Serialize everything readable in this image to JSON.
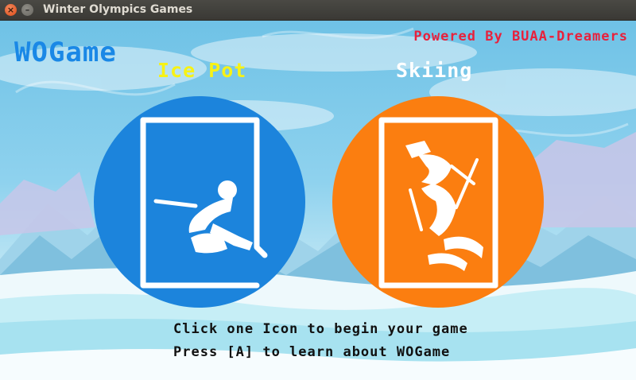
{
  "window": {
    "title": "Winter Olympics Games",
    "close_glyph": "×",
    "minimize_glyph": "–"
  },
  "header": {
    "logo": "WOGame",
    "powered_by": "Powered By BUAA-Dreamers"
  },
  "games": [
    {
      "label": "Ice Pot",
      "icon": "curling-icon",
      "circle_color": "#1c84dc",
      "label_color": "#f7f215"
    },
    {
      "label": "Skiing",
      "icon": "skiing-icon",
      "circle_color": "#fb7e10",
      "label_color": "#ffffff"
    }
  ],
  "instructions": {
    "line1": "Click one Icon to begin your game",
    "line2": "Press [A] to learn about WOGame"
  }
}
